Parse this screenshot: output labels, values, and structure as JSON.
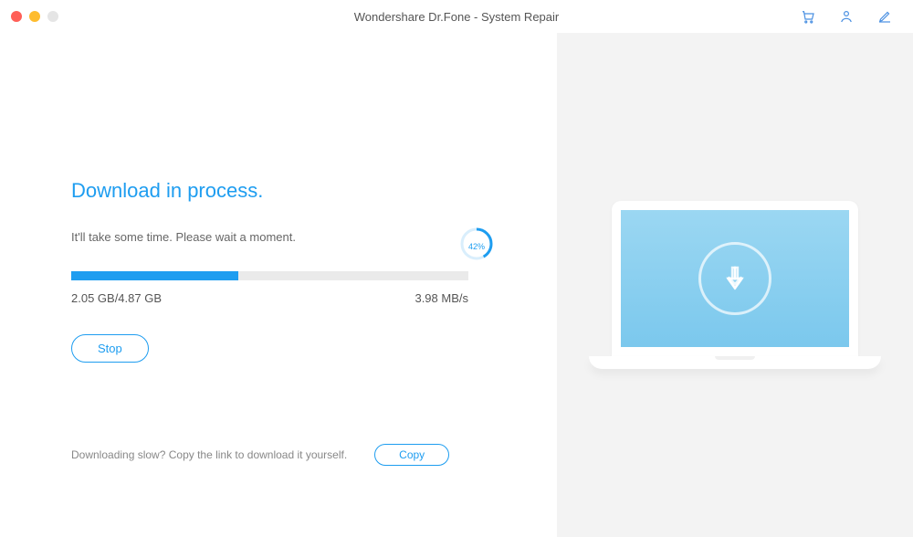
{
  "window": {
    "title": "Wondershare Dr.Fone - System Repair"
  },
  "main": {
    "heading": "Download in process.",
    "subtext": "It'll take some time. Please wait a moment.",
    "progress": {
      "percent_label": "42%",
      "percent": 42,
      "size_label": "2.05 GB/4.87 GB",
      "speed_label": "3.98 MB/s"
    },
    "stop_label": "Stop"
  },
  "footer": {
    "hint": "Downloading slow? Copy the link to download it yourself.",
    "copy_label": "Copy"
  },
  "colors": {
    "accent": "#1e9df0"
  }
}
